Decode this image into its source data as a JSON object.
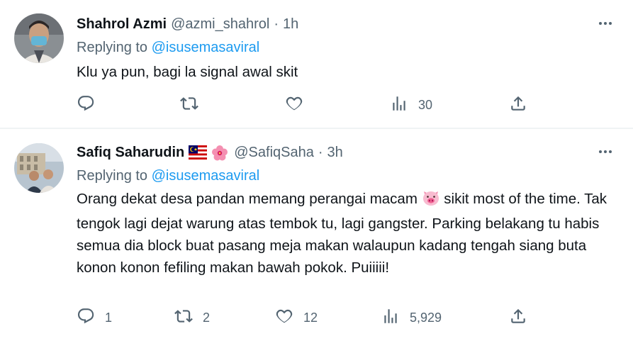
{
  "tweets": [
    {
      "name": "Shahrol Azmi",
      "handle": "@azmi_shahrol",
      "dot": "·",
      "time": "1h",
      "replying_prefix": "Replying to ",
      "replying_to": "@isusemasaviral",
      "text": "Klu ya pun, bagi la signal awal skit",
      "actions": {
        "reply": "",
        "retweet": "",
        "like": "",
        "views": "30"
      }
    },
    {
      "name": "Safiq Saharudin",
      "flags": [
        "malaysia-flag-emoji",
        "hibiscus-emoji"
      ],
      "handle": "@SafiqSaha",
      "dot": "·",
      "time": "3h",
      "replying_prefix": "Replying to ",
      "replying_to": "@isusemasaviral",
      "text_before_emoji": "Orang dekat desa pandan memang perangai macam ",
      "text_emoji": "pig-face-emoji",
      "text_after_emoji": " sikit most of the time. Tak tengok lagi dejat warung atas tembok tu, lagi gangster. Parking belakang tu habis semua dia block buat pasang meja makan walaupun kadang tengah siang buta konon konon fefiling makan bawah pokok. Puiiiii!",
      "actions": {
        "reply": "1",
        "retweet": "2",
        "like": "12",
        "views": "5,929"
      }
    }
  ],
  "colors": {
    "text": "#0f1419",
    "secondary": "#536471",
    "link": "#1d9bf0",
    "divider": "#eff3f4"
  }
}
